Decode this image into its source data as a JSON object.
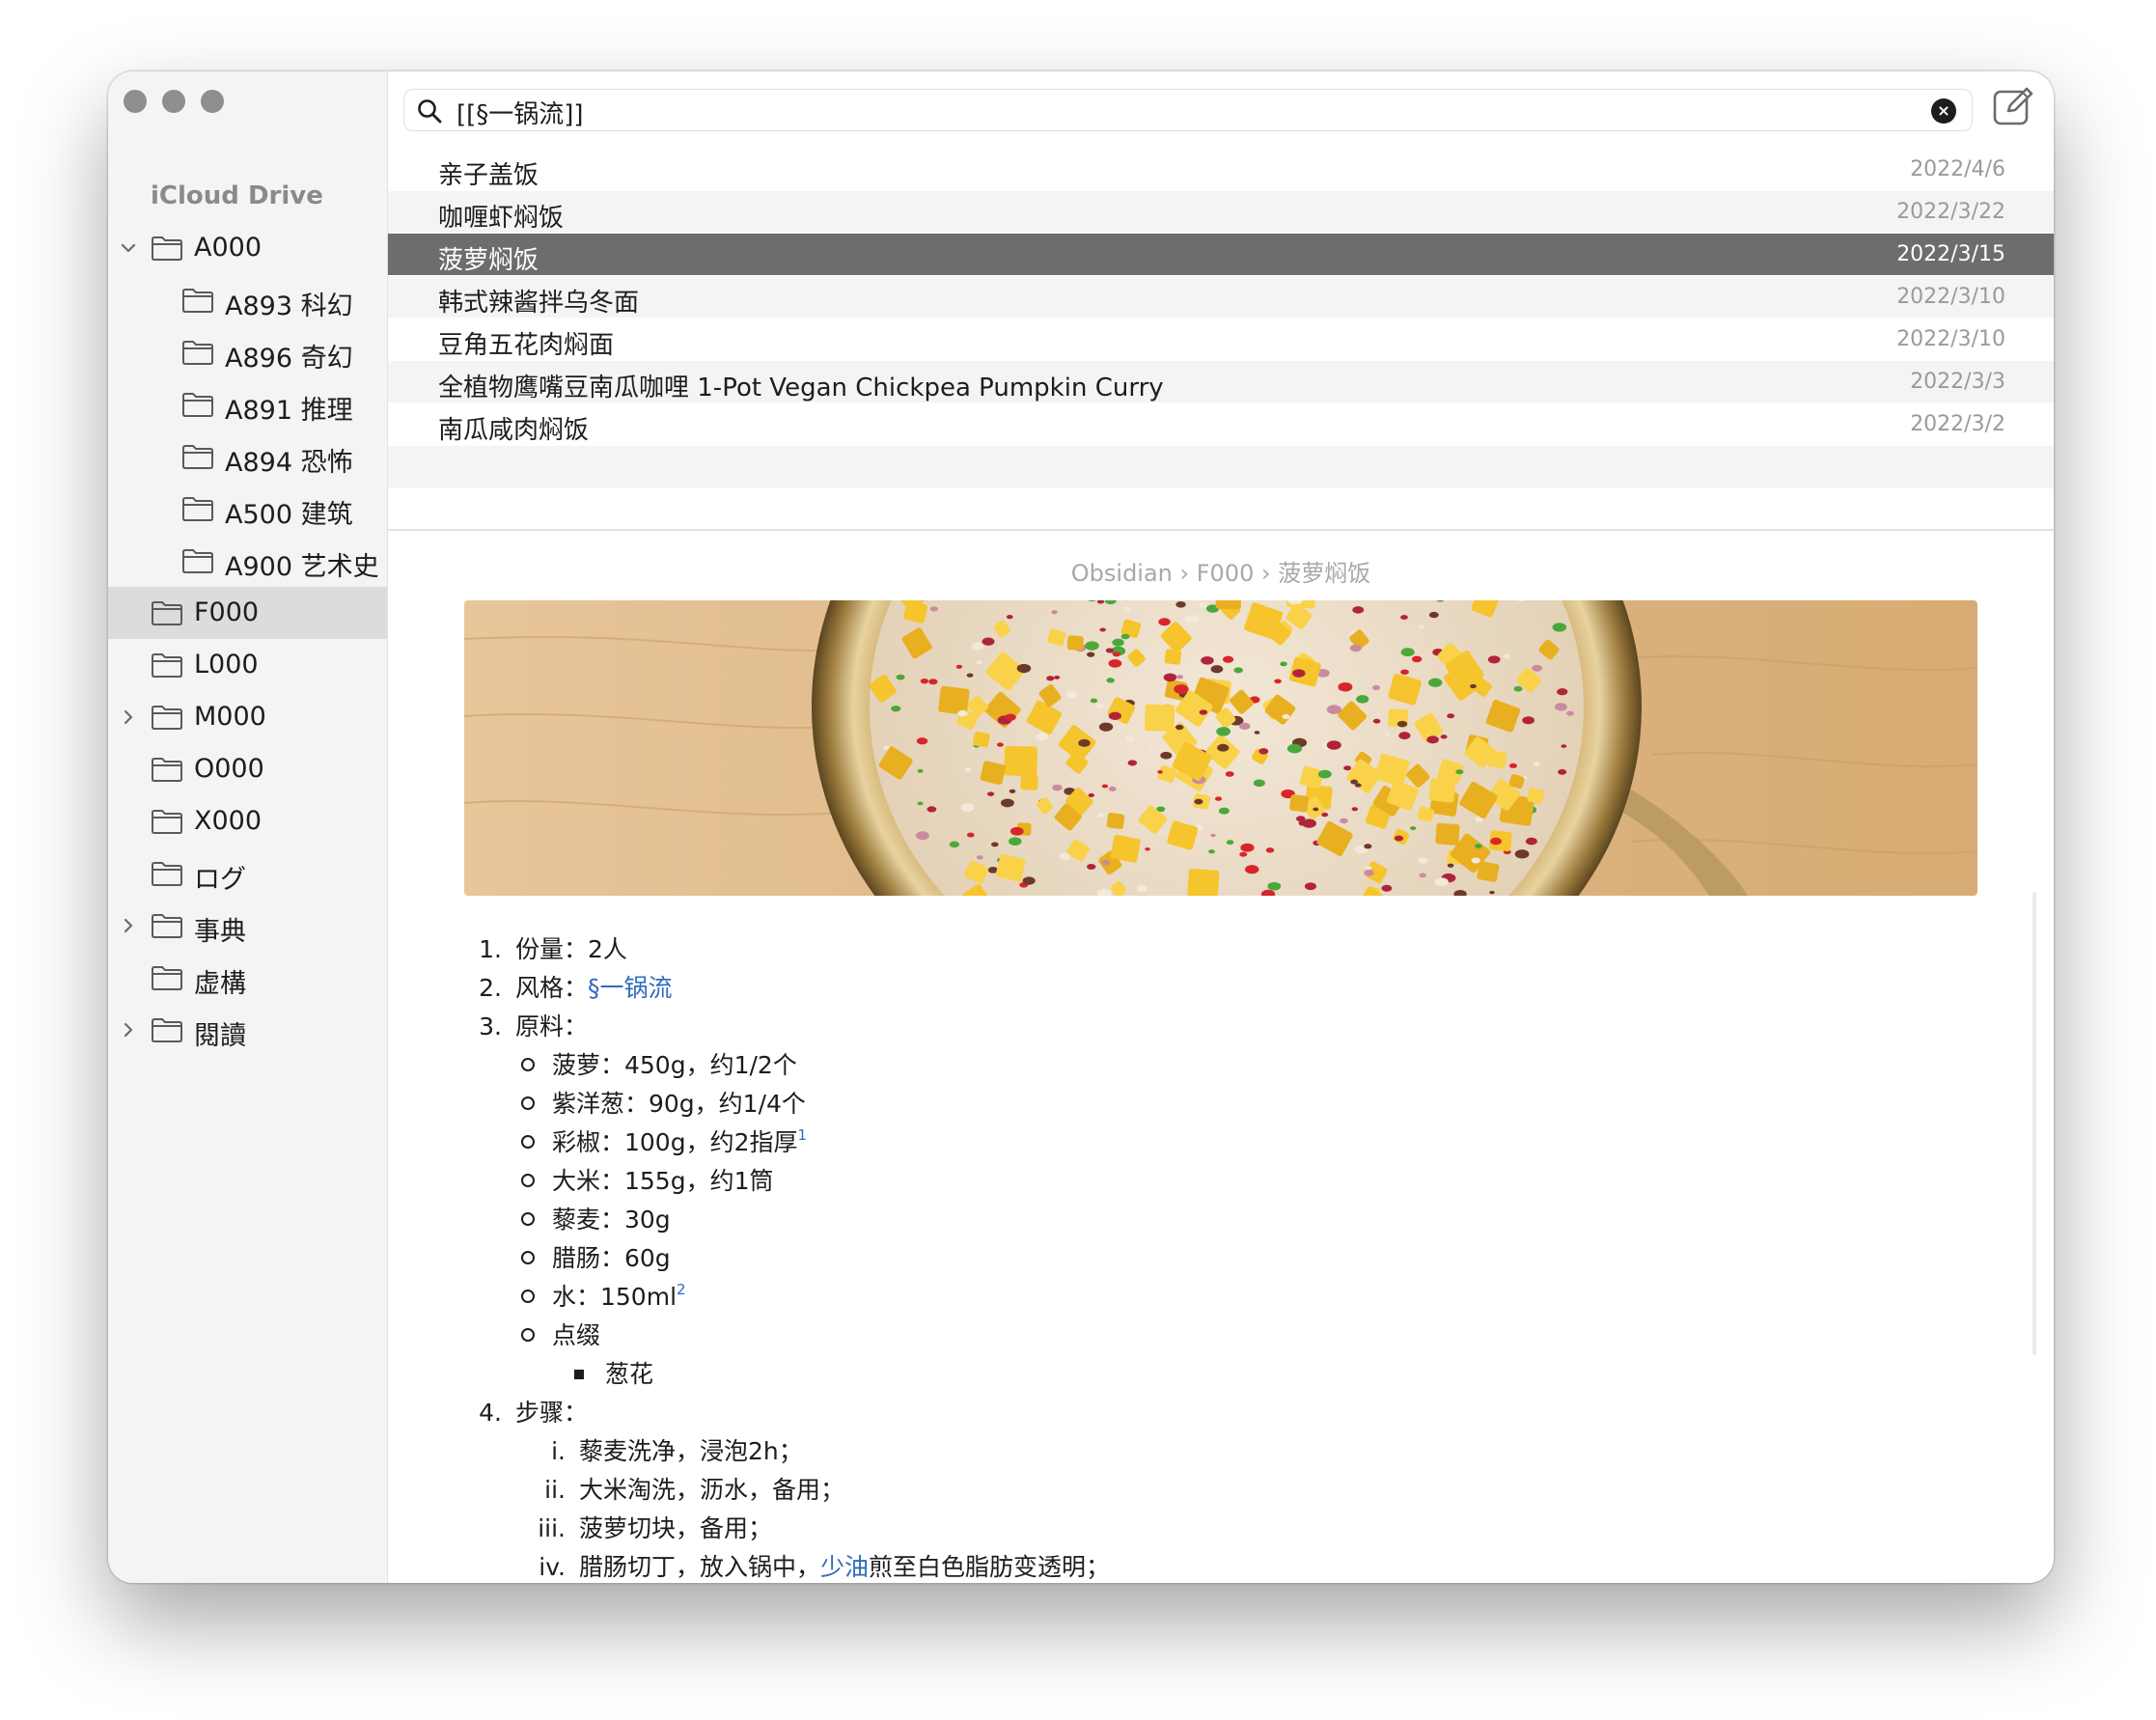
{
  "sidebar": {
    "title": "iCloud Drive",
    "items": [
      {
        "label": "A000",
        "chevron": "down"
      },
      {
        "label": "A893 科幻"
      },
      {
        "label": "A896 奇幻"
      },
      {
        "label": "A891 推理"
      },
      {
        "label": "A894 恐怖"
      },
      {
        "label": "A500 建筑"
      },
      {
        "label": "A900 艺术史"
      },
      {
        "label": "F000",
        "selected": true
      },
      {
        "label": "L000"
      },
      {
        "label": "M000",
        "chevron": "right"
      },
      {
        "label": "O000"
      },
      {
        "label": "X000"
      },
      {
        "label": "ログ"
      },
      {
        "label": "事典",
        "chevron": "right"
      },
      {
        "label": "虚構"
      },
      {
        "label": "閱讀",
        "chevron": "right"
      }
    ]
  },
  "search": {
    "query": "[[§一锅流]]",
    "clear_icon": "×"
  },
  "results": [
    {
      "title": "亲子盖饭",
      "date": "2022/4/6"
    },
    {
      "title": "咖喱虾焖饭",
      "date": "2022/3/22"
    },
    {
      "title": "菠萝焖饭",
      "date": "2022/3/15",
      "selected": true
    },
    {
      "title": "韩式辣酱拌乌冬面",
      "date": "2022/3/10"
    },
    {
      "title": "豆角五花肉焖面",
      "date": "2022/3/10"
    },
    {
      "title": "全植物鹰嘴豆南瓜咖哩 1-Pot Vegan Chickpea Pumpkin Curry",
      "date": "2022/3/3"
    },
    {
      "title": "南瓜咸肉焖饭",
      "date": "2022/3/2"
    }
  ],
  "breadcrumb": "Obsidian › F000 › 菠萝焖饭",
  "note": {
    "item1_num": "1.",
    "item1": "份量：2人",
    "item2_num": "2.",
    "item2_label": "风格：",
    "item2_link": "§一锅流",
    "item3_num": "3.",
    "item3": "原料：",
    "ing1": "菠萝：450g，约1/2个",
    "ing2": "紫洋葱：90g，约1/4个",
    "ing3": "彩椒：100g，约2指厚",
    "ing3_fn": "1",
    "ing4": "大米：155g，约1筒",
    "ing5": "藜麦：30g",
    "ing6": "腊肠：60g",
    "ing7": "水：150ml",
    "ing7_fn": "2",
    "ing8": "点缀",
    "garnish1": "葱花",
    "item4_num": "4.",
    "item4": "步骤：",
    "step1_num": "i.",
    "step1": "藜麦洗净，浸泡2h；",
    "step2_num": "ii.",
    "step2": "大米淘洗，沥水，备用；",
    "step3_num": "iii.",
    "step3": "菠萝切块，备用；",
    "step4_num": "iv.",
    "step4_pre": "腊肠切丁，放入锅中，",
    "step4_link": "少油",
    "step4_post": "煎至白色脂肪变透明；"
  },
  "colors": {
    "accent_link": "#2f6bbf",
    "selected_row": "#6d6d6d"
  },
  "icons": [
    "search-icon",
    "clear-search-icon",
    "compose-icon",
    "folder-icon",
    "chevron-down-icon",
    "chevron-right-icon"
  ]
}
